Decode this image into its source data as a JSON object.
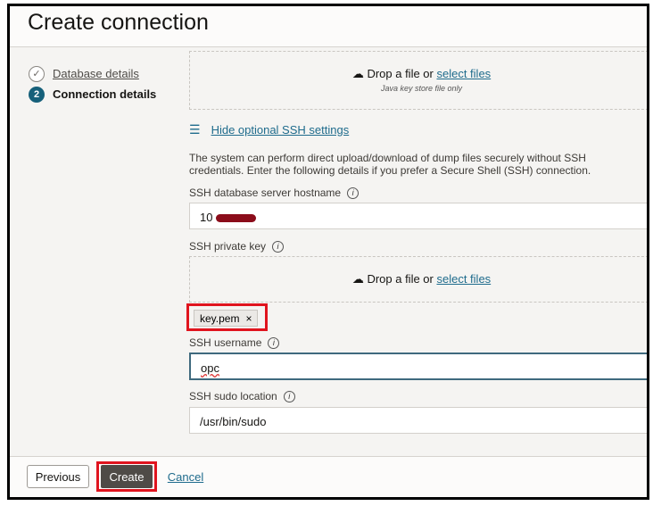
{
  "title": "Create connection",
  "steps": [
    {
      "label": "Database details",
      "num": ""
    },
    {
      "label": "Connection details",
      "num": "2"
    }
  ],
  "dropzone1": {
    "text": "Drop a file or ",
    "link": "select files",
    "hint": "Java key store file only"
  },
  "toggle_ssh": "Hide optional SSH settings",
  "description": "The system can perform direct upload/download of dump files securely without SSH credentials. Enter the following details if you prefer a Secure Shell (SSH) connection.",
  "hostname": {
    "label": "SSH database server hostname",
    "value": "10"
  },
  "private_key": {
    "label": "SSH private key",
    "drop_text": "Drop a file or ",
    "drop_link": "select files",
    "file": "key.pem",
    "remove": "×"
  },
  "username": {
    "label": "SSH username",
    "value": "opc"
  },
  "sudo": {
    "label": "SSH sudo location",
    "value": "/usr/bin/sudo"
  },
  "footer": {
    "previous": "Previous",
    "create": "Create",
    "cancel": "Cancel"
  }
}
